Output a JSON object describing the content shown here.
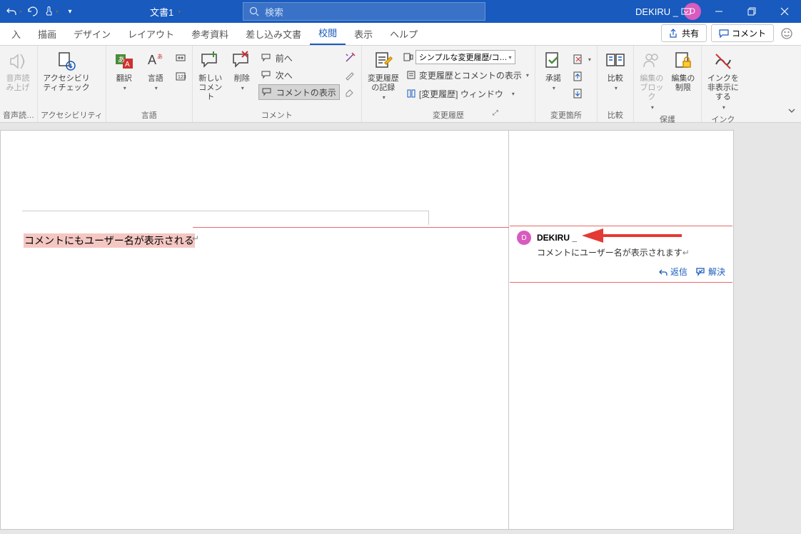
{
  "titlebar": {
    "doc_name": "文書1",
    "search_placeholder": "検索",
    "user_name": "DEKIRU _"
  },
  "tabs": {
    "items": [
      "入",
      "描画",
      "デザイン",
      "レイアウト",
      "参考資料",
      "差し込み文書",
      "校閲",
      "表示",
      "ヘルプ"
    ],
    "share": "共有",
    "comment": "コメント"
  },
  "ribbon": {
    "g0": {
      "read_aloud": "音声読み上げ",
      "label": "音声読…"
    },
    "g1": {
      "check": "アクセシビリティチェック",
      "label": "アクセシビリティ"
    },
    "g2": {
      "translate": "翻訳",
      "language": "言語",
      "label": "言語"
    },
    "g3": {
      "new_comment": "新しいコメント",
      "delete": "削除",
      "prev": "前へ",
      "next": "次へ",
      "show": "コメントの表示",
      "label": "コメント"
    },
    "g4": {
      "track": "変更履歴の記録",
      "combo": "シンプルな変更履歴/コ…",
      "show_markup": "変更履歴とコメントの表示",
      "pane": "[変更履歴] ウィンドウ",
      "label": "変更履歴"
    },
    "g5": {
      "accept": "承諾",
      "label": "変更箇所"
    },
    "g6": {
      "compare": "比較",
      "label": "比較"
    },
    "g7": {
      "block": "編集のブロック",
      "restrict": "編集の制限",
      "label": "保護"
    },
    "g8": {
      "ink": "インクを非表示にする",
      "label": "インク"
    }
  },
  "document": {
    "highlighted": "コメントにもユーザー名が表示される"
  },
  "comment": {
    "author": "DEKIRU _",
    "body": "コメントにユーザー名が表示されます",
    "reply": "返信",
    "resolve": "解決"
  }
}
